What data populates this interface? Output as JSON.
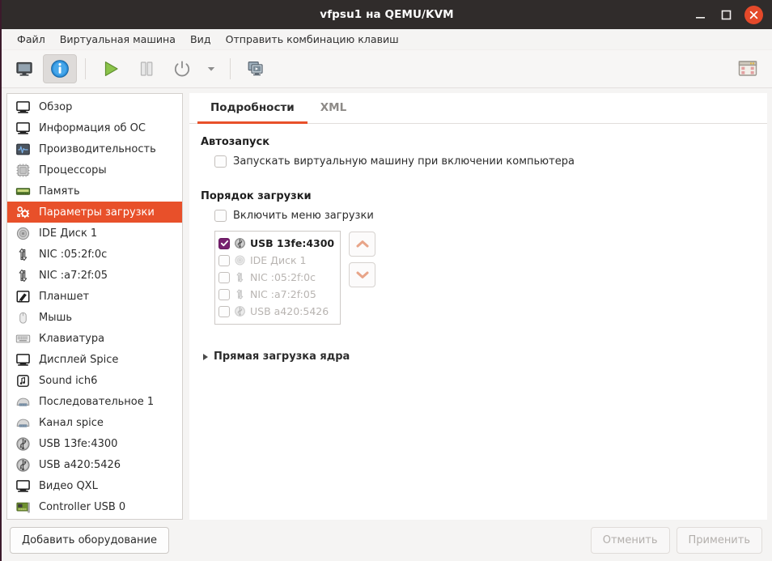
{
  "window": {
    "title": "vfpsu1 на QEMU/KVM",
    "controls": {
      "minimize": "minimize-icon",
      "maximize": "maximize-icon",
      "close": "close-icon"
    }
  },
  "menubar": {
    "items": [
      {
        "label": "Файл",
        "name": "menu-file"
      },
      {
        "label": "Виртуальная машина",
        "name": "menu-virtual-machine"
      },
      {
        "label": "Вид",
        "name": "menu-view"
      },
      {
        "label": "Отправить комбинацию клавиш",
        "name": "menu-send-key"
      }
    ]
  },
  "toolbar": {
    "buttons": [
      {
        "name": "show-console-button",
        "icon": "monitor-icon",
        "active": false
      },
      {
        "name": "show-details-button",
        "icon": "info-icon",
        "active": true
      },
      {
        "name": "run-button",
        "icon": "play-icon",
        "active": false
      },
      {
        "name": "pause-button",
        "icon": "pause-icon",
        "active": false
      },
      {
        "name": "shutdown-button",
        "icon": "power-icon",
        "active": false
      },
      {
        "name": "shutdown-menu-button",
        "icon": "chevron-down-icon",
        "active": false
      },
      {
        "name": "snapshots-button",
        "icon": "clone-windows-icon",
        "active": false
      }
    ],
    "right_button": {
      "name": "fullscreen-button",
      "icon": "window-grid-icon"
    }
  },
  "sidebar": {
    "items": [
      {
        "label": "Обзор",
        "icon": "monitor-icon",
        "name": "sidebar-item-overview",
        "selected": false
      },
      {
        "label": "Информация об ОС",
        "icon": "monitor-icon",
        "name": "sidebar-item-os-info",
        "selected": false
      },
      {
        "label": "Производительность",
        "icon": "performance-icon",
        "name": "sidebar-item-performance",
        "selected": false
      },
      {
        "label": "Процессоры",
        "icon": "cpu-icon",
        "name": "sidebar-item-cpus",
        "selected": false
      },
      {
        "label": "Память",
        "icon": "memory-icon",
        "name": "sidebar-item-memory",
        "selected": false
      },
      {
        "label": "Параметры загрузки",
        "icon": "boot-options-icon",
        "name": "sidebar-item-boot-options",
        "selected": true
      },
      {
        "label": "IDE Диск 1",
        "icon": "disk-icon",
        "name": "sidebar-item-ide-disk-1",
        "selected": false
      },
      {
        "label": "NIC :05:2f:0c",
        "icon": "network-icon",
        "name": "sidebar-item-nic-05-2f-0c",
        "selected": false
      },
      {
        "label": "NIC :a7:2f:05",
        "icon": "network-icon",
        "name": "sidebar-item-nic-a7-2f-05",
        "selected": false
      },
      {
        "label": "Планшет",
        "icon": "tablet-icon",
        "name": "sidebar-item-tablet",
        "selected": false
      },
      {
        "label": "Мышь",
        "icon": "mouse-icon",
        "name": "sidebar-item-mouse",
        "selected": false
      },
      {
        "label": "Клавиатура",
        "icon": "keyboard-icon",
        "name": "sidebar-item-keyboard",
        "selected": false
      },
      {
        "label": "Дисплей Spice",
        "icon": "monitor-icon",
        "name": "sidebar-item-display-spice",
        "selected": false
      },
      {
        "label": "Sound ich6",
        "icon": "sound-icon",
        "name": "sidebar-item-sound-ich6",
        "selected": false
      },
      {
        "label": "Последовательное 1",
        "icon": "serial-icon",
        "name": "sidebar-item-serial-1",
        "selected": false
      },
      {
        "label": "Канал spice",
        "icon": "serial-icon",
        "name": "sidebar-item-channel-spice",
        "selected": false
      },
      {
        "label": "USB 13fe:4300",
        "icon": "usb-icon",
        "name": "sidebar-item-usb-13fe-4300",
        "selected": false
      },
      {
        "label": "USB a420:5426",
        "icon": "usb-icon",
        "name": "sidebar-item-usb-a420-5426",
        "selected": false
      },
      {
        "label": "Видео QXL",
        "icon": "monitor-icon",
        "name": "sidebar-item-video-qxl",
        "selected": false
      },
      {
        "label": "Controller USB 0",
        "icon": "controller-icon",
        "name": "sidebar-item-controller-usb-0",
        "selected": false
      }
    ]
  },
  "main": {
    "tabs": [
      {
        "label": "Подробности",
        "name": "tab-details",
        "active": true
      },
      {
        "label": "XML",
        "name": "tab-xml",
        "active": false
      }
    ],
    "autostart": {
      "title": "Автозапуск",
      "checkbox_label": "Запускать виртуальную машину при включении компьютера",
      "checked": false
    },
    "boot_order": {
      "title": "Порядок загрузки",
      "menu_checkbox_label": "Включить меню загрузки",
      "menu_checked": false,
      "devices": [
        {
          "label": "USB 13fe:4300",
          "icon": "usb-icon",
          "checked": true
        },
        {
          "label": "IDE Диск 1",
          "icon": "disk-icon",
          "checked": false
        },
        {
          "label": "NIC :05:2f:0c",
          "icon": "network-icon",
          "checked": false
        },
        {
          "label": "NIC :a7:2f:05",
          "icon": "network-icon",
          "checked": false
        },
        {
          "label": "USB a420:5426",
          "icon": "usb-icon",
          "checked": false
        }
      ],
      "move_up": "move-up-button",
      "move_down": "move-down-button"
    },
    "kernel_expander": {
      "label": "Прямая загрузка ядра",
      "expanded": false
    }
  },
  "footer": {
    "add_hardware": "Добавить оборудование",
    "cancel": "Отменить",
    "apply": "Применить",
    "cancel_disabled": true,
    "apply_disabled": true
  },
  "colors": {
    "accent": "#e8502a",
    "titlebar": "#302c2b",
    "close": "#e4492a",
    "checkbox_checked": "#77216f",
    "arrow": "#e8a488"
  }
}
